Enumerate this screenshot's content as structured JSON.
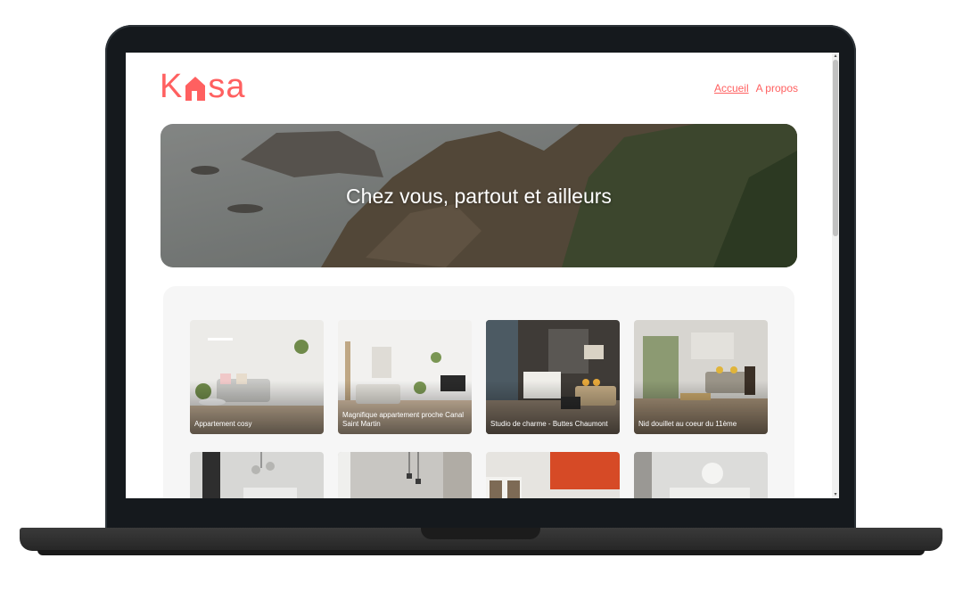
{
  "header": {
    "logo_text": "Kasa",
    "nav": [
      {
        "label": "Accueil",
        "active": true
      },
      {
        "label": "A propos",
        "active": false
      }
    ]
  },
  "banner": {
    "title": "Chez vous, partout et ailleurs"
  },
  "cards": [
    {
      "title": "Appartement cosy"
    },
    {
      "title": "Magnifique appartement proche Canal Saint Martin"
    },
    {
      "title": "Studio de charme - Buttes Chaumont"
    },
    {
      "title": "Nid douillet au coeur du 11ème"
    },
    {
      "title": ""
    },
    {
      "title": ""
    },
    {
      "title": ""
    },
    {
      "title": ""
    }
  ],
  "colors": {
    "brand": "#ff6060",
    "gallery_bg": "#f6f6f6",
    "laptop_bezel": "#15191d"
  }
}
